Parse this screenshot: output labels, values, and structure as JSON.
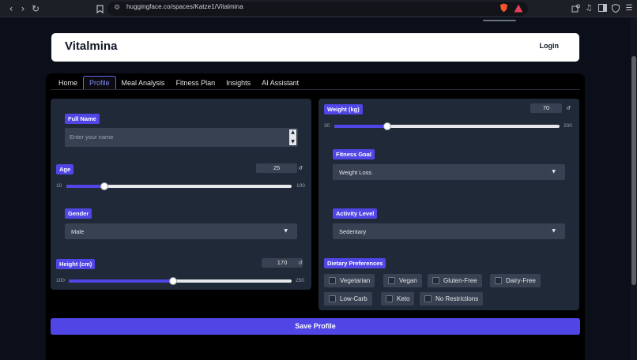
{
  "browser": {
    "url": "huggingface.co/spaces/Katze1/Vitalmina"
  },
  "header": {
    "brand": "Vitalmina",
    "login_label": "Login"
  },
  "tabs": [
    {
      "label": "Home"
    },
    {
      "label": "Profile",
      "active": true
    },
    {
      "label": "Meal Analysis"
    },
    {
      "label": "Fitness Plan"
    },
    {
      "label": "Insights"
    },
    {
      "label": "AI Assistant"
    }
  ],
  "profile": {
    "full_name": {
      "label": "Full Name",
      "placeholder": "Enter your name"
    },
    "age": {
      "label": "Age",
      "value": "25",
      "min": "10",
      "max": "100"
    },
    "gender": {
      "label": "Gender",
      "value": "Male"
    },
    "height": {
      "label": "Height (cm)",
      "value": "170",
      "min": "100",
      "max": "250"
    },
    "weight": {
      "label": "Weight (kg)",
      "value": "70",
      "min": "30",
      "max": "200"
    },
    "fitness_goal": {
      "label": "Fitness Goal",
      "value": "Weight Loss"
    },
    "activity_level": {
      "label": "Activity Level",
      "value": "Sedentary"
    },
    "dietary": {
      "label": "Dietary Preferences",
      "options": [
        "Vegetarian",
        "Vegan",
        "Gluten-Free",
        "Dairy-Free",
        "Low-Carb",
        "Keto",
        "No Restrictions"
      ]
    },
    "save_label": "Save Profile"
  },
  "colors": {
    "accent": "#4f46e5",
    "panel": "#1f2937",
    "input": "#374151"
  }
}
